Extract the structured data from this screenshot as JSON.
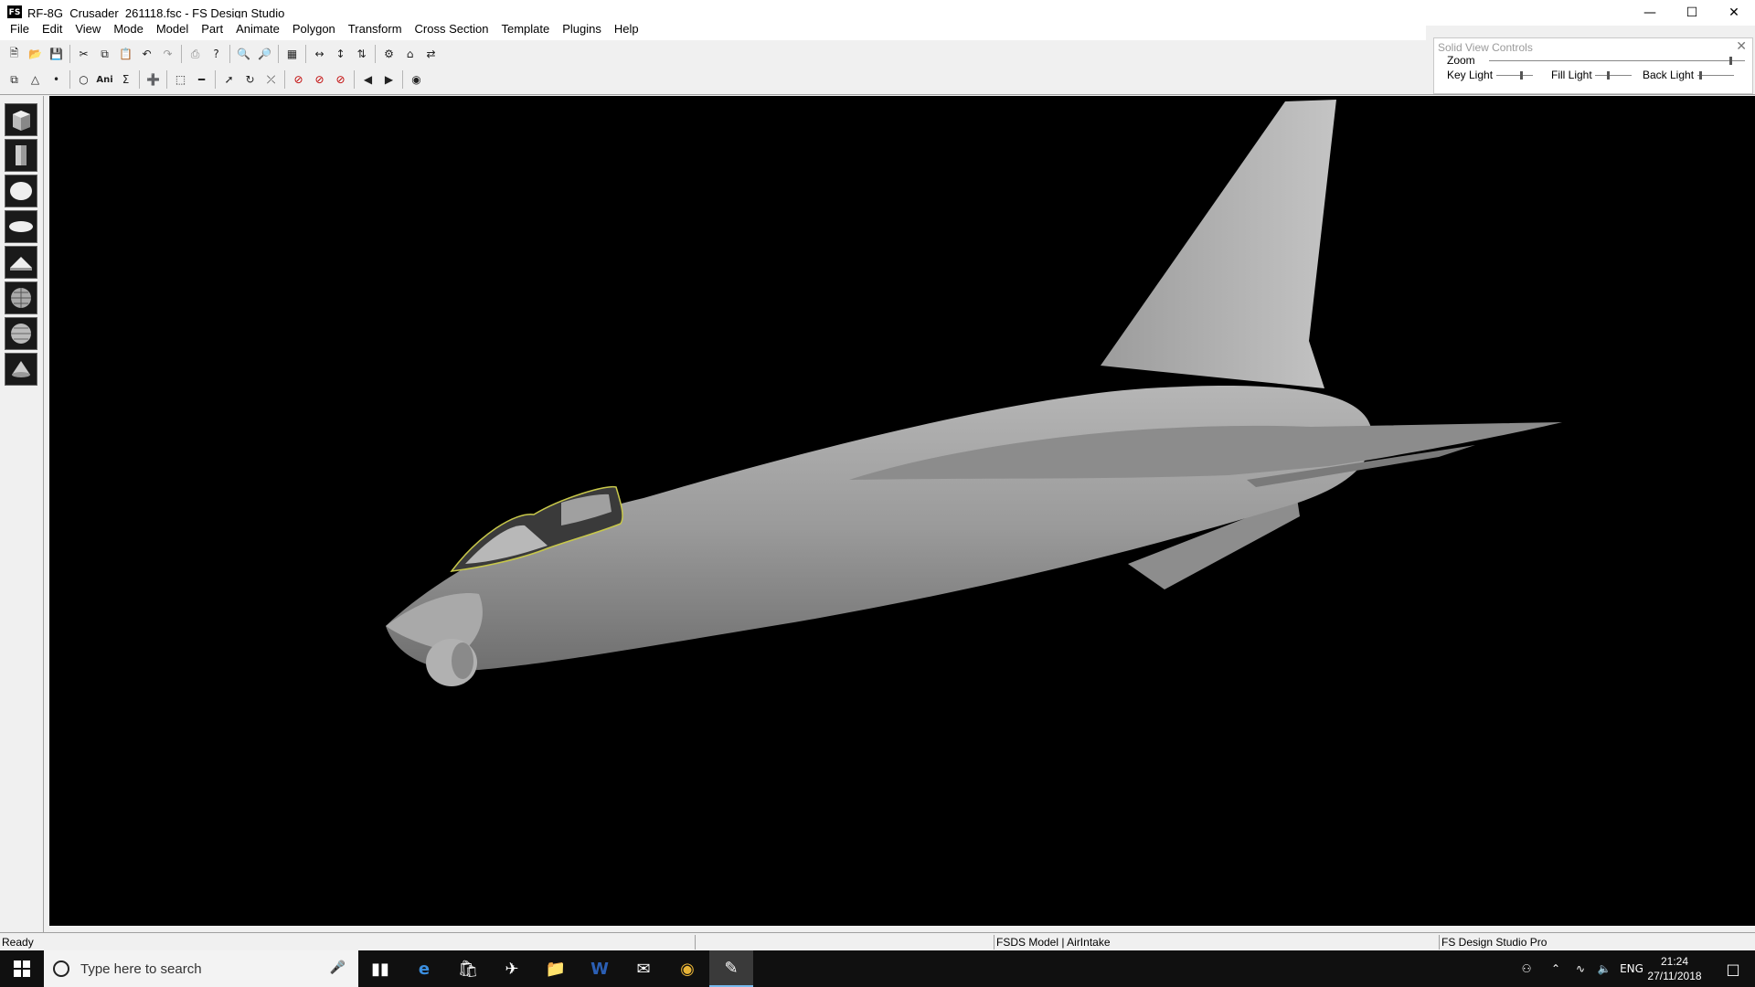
{
  "window": {
    "title": "RF-8G_Crusader_261118.fsc - FS Design Studio",
    "app_icon_glyph": "FS"
  },
  "menu": [
    "File",
    "Edit",
    "View",
    "Mode",
    "Model",
    "Part",
    "Animate",
    "Polygon",
    "Transform",
    "Cross Section",
    "Template",
    "Plugins",
    "Help"
  ],
  "toolbar": {
    "row1_icons": [
      "new-file-icon",
      "open-file-icon",
      "save-icon",
      "cut-icon",
      "copy-icon",
      "paste-icon",
      "undo-icon",
      "redo-icon",
      "print-icon",
      "help-icon",
      "zoom-in-icon",
      "zoom-out-icon",
      "grid-icon",
      "flip-x-icon",
      "flip-y-icon",
      "flip-z-icon",
      "view-a-icon",
      "view-b-icon",
      "view-c-icon"
    ],
    "row2_icons": [
      "copy-part-icon",
      "triangle-icon",
      "point-icon",
      "circle-icon",
      "ani-icon",
      "sigma-icon",
      "add-icon",
      "select-icon",
      "measure-icon",
      "move-icon",
      "rotate-icon",
      "scale-icon",
      "red-a-icon",
      "red-b-icon",
      "red-c-icon",
      "prev-icon",
      "next-icon",
      "binoculars-icon"
    ],
    "ani_label": "Ani",
    "sigma_label": "Σ"
  },
  "solid_view_controls": {
    "title": "Solid View Controls",
    "zoom_label": "Zoom",
    "key_light_label": "Key Light",
    "fill_light_label": "Fill Light",
    "back_light_label": "Back Light",
    "zoom_value": 0.95,
    "key_light_value": 0.7,
    "fill_light_value": 0.35,
    "back_light_value": 0.05
  },
  "shapes": [
    "cube-icon",
    "cylinder-icon",
    "sphere-icon",
    "ellipsoid-icon",
    "wedge-icon",
    "globe-a-icon",
    "globe-b-icon",
    "cone-icon"
  ],
  "status": {
    "ready": "Ready",
    "model_part": "FSDS Model | AirIntake",
    "product": "FS Design Studio Pro"
  },
  "taskbar": {
    "search_placeholder": "Type here to search",
    "lang": "ENG",
    "time": "21:24",
    "date": "27/11/2018"
  },
  "colors": {
    "viewport_bg": "#000000",
    "aircraft": "#9a9a9a",
    "canopy_outline": "#c8c84a"
  }
}
